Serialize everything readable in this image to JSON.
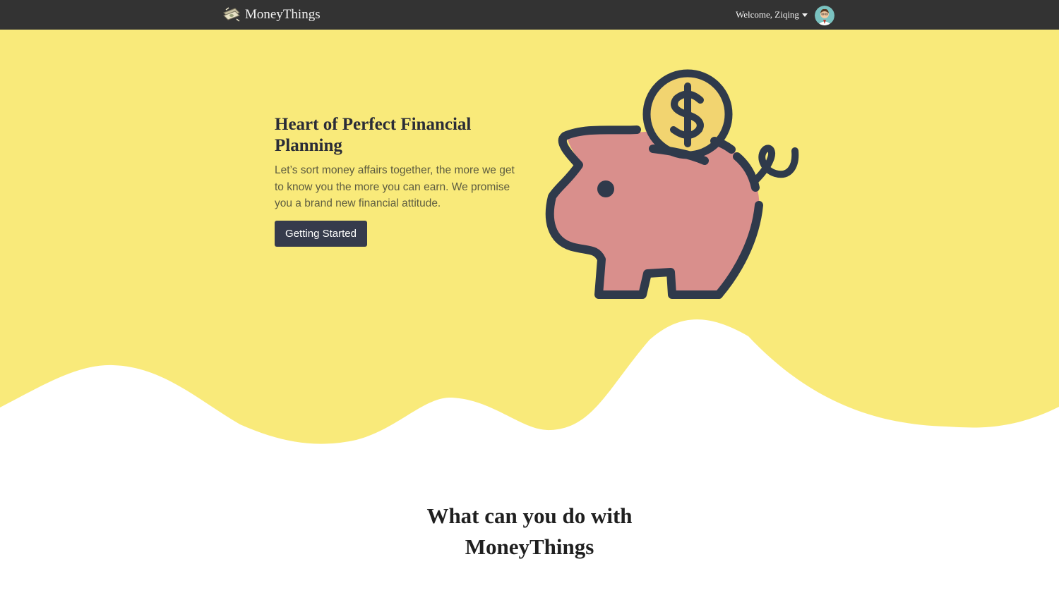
{
  "navbar": {
    "brand": "MoneyThings",
    "welcome": "Welcome, Ziqing",
    "avatar_icon": "user-avatar-icon",
    "logo_icon": "money-stack-icon",
    "background_color": "#333333"
  },
  "hero": {
    "title": "Heart of Perfect Financial Planning",
    "description": "Let’s sort money affairs together, the more we get to know you the more you can earn. We promise you a brand new financial attitude.",
    "button_label": "Getting Started",
    "illustration_icon": "piggy-bank-icon",
    "background_color": "#f9ea7a",
    "button_color": "#363b4c"
  },
  "features": {
    "title_line1": "What can you do with",
    "title_line2": "MoneyThings"
  }
}
